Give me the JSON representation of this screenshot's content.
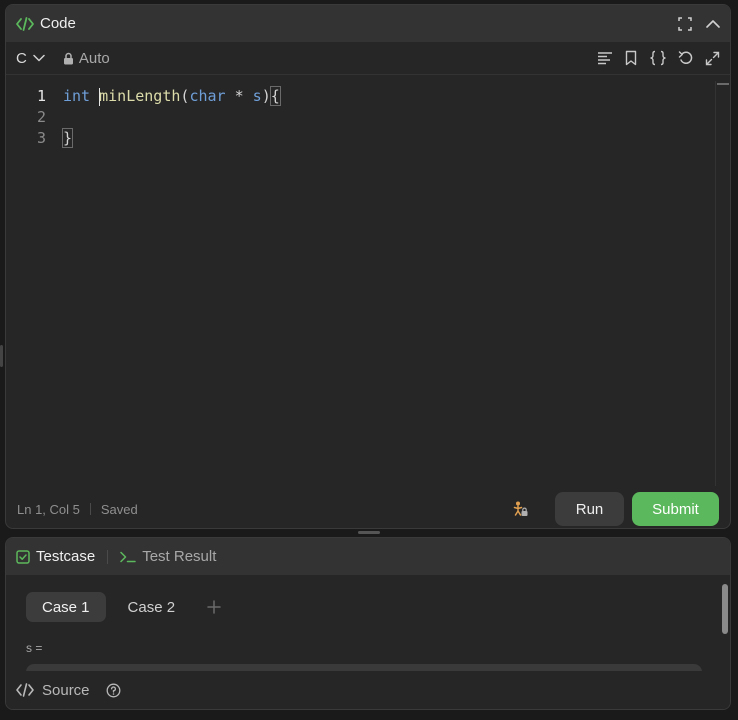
{
  "code_panel": {
    "title": "Code",
    "language": "C",
    "mode": "Auto",
    "accent": "#5cb85c"
  },
  "editor": {
    "line_numbers": [
      "1",
      "2",
      "3"
    ],
    "code": {
      "line1": {
        "t1": "int",
        "t2": " ",
        "t3": "minLength",
        "t4": "(",
        "t5": "char",
        "t6": " * ",
        "t7": "s",
        "t8": ")",
        "t9": "{"
      },
      "line3": "}"
    }
  },
  "status": {
    "position": "Ln 1, Col 5",
    "saved": "Saved"
  },
  "actions": {
    "run_label": "Run",
    "submit_label": "Submit",
    "submit_color": "#5cb85c"
  },
  "test_panel": {
    "tabs": [
      {
        "label": "Testcase"
      },
      {
        "label": "Test Result"
      }
    ],
    "cases": [
      "Case 1",
      "Case 2"
    ],
    "add_symbol": "+",
    "param_label": "s =",
    "footer_label": "Source"
  },
  "icons": {
    "code": "code-brackets-icon",
    "fullscreen": "fullscreen-icon",
    "collapse": "chevron-up-icon",
    "chevron": "chevron-down-icon",
    "lock": "lock-icon",
    "format": "align-left-icon",
    "bookmark": "bookmark-icon",
    "braces": "braces-icon",
    "reset": "undo-icon",
    "expand": "expand-icon",
    "debug": "debugger-icon",
    "checkbox": "checkbox-icon",
    "terminal": "terminal-icon",
    "help": "help-icon"
  }
}
